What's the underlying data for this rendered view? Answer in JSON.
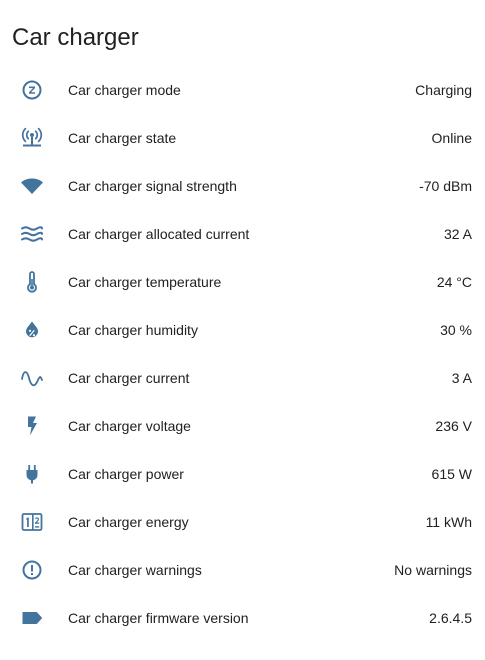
{
  "card": {
    "title": "Car charger"
  },
  "icon_color": "#44739e",
  "rows": [
    {
      "icon": "alpha-z-circle-outline-icon",
      "label": "Car charger mode",
      "value": "Charging"
    },
    {
      "icon": "access-point-network-icon",
      "label": "Car charger state",
      "value": "Online"
    },
    {
      "icon": "wifi-icon",
      "label": "Car charger signal strength",
      "value": "-70 dBm"
    },
    {
      "icon": "waves-icon",
      "label": "Car charger allocated current",
      "value": "32 A"
    },
    {
      "icon": "thermometer-icon",
      "label": "Car charger temperature",
      "value": "24 °C"
    },
    {
      "icon": "water-percent-icon",
      "label": "Car charger humidity",
      "value": "30 %"
    },
    {
      "icon": "sine-wave-icon",
      "label": "Car charger current",
      "value": "3 A"
    },
    {
      "icon": "flash-icon",
      "label": "Car charger voltage",
      "value": "236 V"
    },
    {
      "icon": "power-plug-icon",
      "label": "Car charger power",
      "value": "615 W"
    },
    {
      "icon": "counter-icon",
      "label": "Car charger energy",
      "value": "11 kWh"
    },
    {
      "icon": "alert-circle-outline-icon",
      "label": "Car charger warnings",
      "value": "No warnings"
    },
    {
      "icon": "label-icon",
      "label": "Car charger firmware version",
      "value": "2.6.4.5"
    }
  ]
}
